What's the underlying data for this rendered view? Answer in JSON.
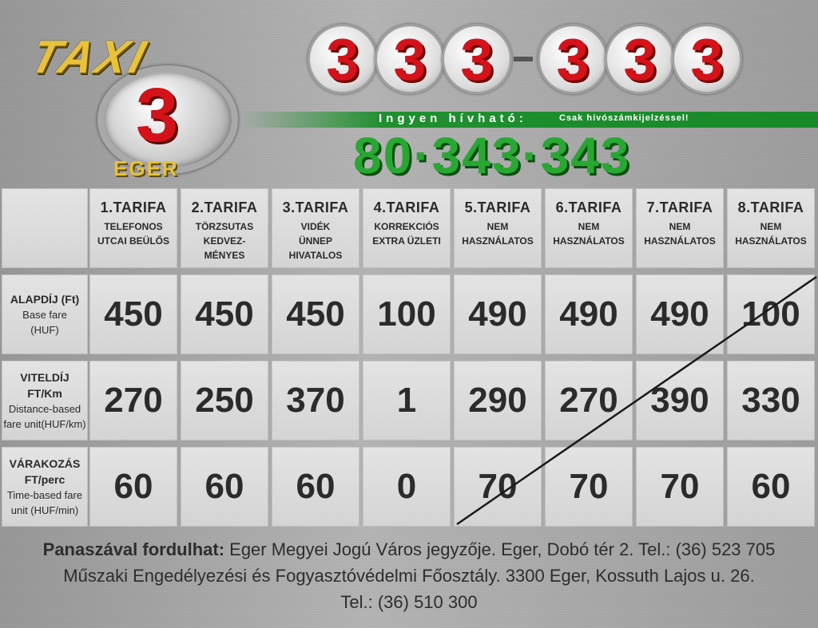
{
  "header": {
    "logo_text": "TAXI",
    "logo_number": "3",
    "logo_city": "EGER",
    "phone_main_digits": [
      "3",
      "3",
      "3",
      "3",
      "3",
      "3"
    ],
    "free_call_label": "Ingyen hívható:",
    "free_call_note": "Csak hívószámkijelzéssel!",
    "free_phone": "80·343·343",
    "colors": {
      "red": "#d3121a",
      "green": "#28a832",
      "gold": "#e7c23a"
    }
  },
  "table": {
    "tariffs": [
      {
        "title": "1.TARIFA",
        "sub": "TELEFONOS\nUTCAI BEÜLŐS"
      },
      {
        "title": "2.TARIFA",
        "sub": "TÖRZSUTAS\nKEDVEZ-\nMÉNYES"
      },
      {
        "title": "3.TARIFA",
        "sub": "VIDÉK\nÜNNEP\nHIVATALOS"
      },
      {
        "title": "4.TARIFA",
        "sub": "KORREKCIÓS\nEXTRA ÜZLETI"
      },
      {
        "title": "5.TARIFA",
        "sub": "NEM\nHASZNÁLATOS"
      },
      {
        "title": "6.TARIFA",
        "sub": "NEM\nHASZNÁLATOS"
      },
      {
        "title": "7.TARIFA",
        "sub": "NEM\nHASZNÁLATOS"
      },
      {
        "title": "8.TARIFA",
        "sub": "NEM\nHASZNÁLATOS"
      }
    ],
    "rows": [
      {
        "label_hu": "ALAPDÍJ (Ft)",
        "label_en": "Base fare\n(HUF)",
        "values": [
          "450",
          "450",
          "450",
          "100",
          "490",
          "490",
          "490",
          "100"
        ]
      },
      {
        "label_hu": "VITELDÍJ\nFT/Km",
        "label_en": "Distance-based\nfare unit(HUF/km)",
        "values": [
          "270",
          "250",
          "370",
          "1",
          "290",
          "270",
          "390",
          "330"
        ]
      },
      {
        "label_hu": "VÁRAKOZÁS\nFT/perc",
        "label_en": "Time-based fare\nunit (HUF/min)",
        "values": [
          "60",
          "60",
          "60",
          "0",
          "70",
          "70",
          "70",
          "60"
        ]
      }
    ]
  },
  "footer": {
    "complaint_label": "Panaszával fordulhat:",
    "line1_rest": " Eger Megyei Jogú Város jegyzője. Eger, Dobó tér 2. Tel.: (36) 523 705",
    "line2": "Műszaki Engedélyezési és Fogyasztóvédelmi Főosztály. 3300 Eger, Kossuth Lajos u. 26.",
    "line3": "Tel.: (36) 510 300"
  }
}
